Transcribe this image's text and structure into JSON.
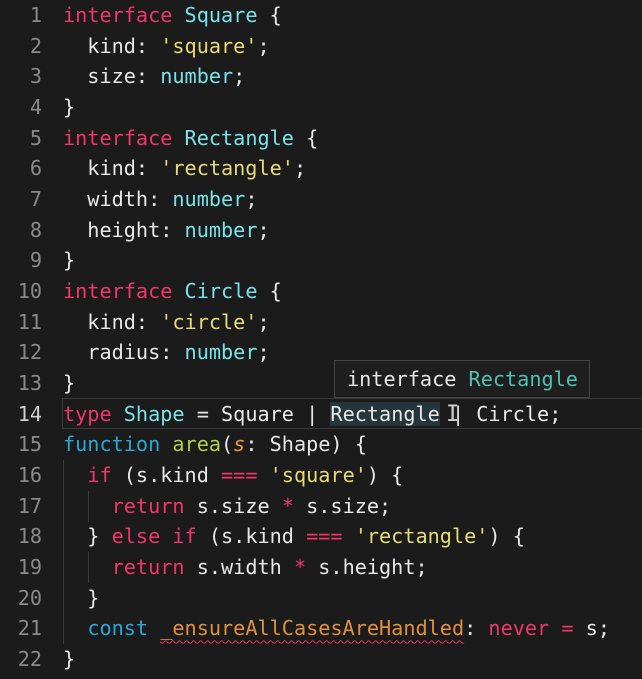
{
  "editor": {
    "current_line": 14,
    "lines": [
      {
        "n": "1",
        "tokens": [
          [
            "interface ",
            "kw"
          ],
          [
            "Square",
            "ty"
          ],
          [
            " {",
            "pl"
          ]
        ]
      },
      {
        "n": "2",
        "tokens": [
          [
            "  kind: ",
            "pl"
          ],
          [
            "'square'",
            "st"
          ],
          [
            ";",
            "pl"
          ]
        ]
      },
      {
        "n": "3",
        "tokens": [
          [
            "  size: ",
            "pl"
          ],
          [
            "number",
            "ty"
          ],
          [
            ";",
            "pl"
          ]
        ]
      },
      {
        "n": "4",
        "tokens": [
          [
            "}",
            "pl"
          ]
        ]
      },
      {
        "n": "5",
        "tokens": [
          [
            "interface ",
            "kw"
          ],
          [
            "Rectangle",
            "ty"
          ],
          [
            " {",
            "pl"
          ]
        ]
      },
      {
        "n": "6",
        "tokens": [
          [
            "  kind: ",
            "pl"
          ],
          [
            "'rectangle'",
            "st"
          ],
          [
            ";",
            "pl"
          ]
        ]
      },
      {
        "n": "7",
        "tokens": [
          [
            "  width: ",
            "pl"
          ],
          [
            "number",
            "ty"
          ],
          [
            ";",
            "pl"
          ]
        ]
      },
      {
        "n": "8",
        "tokens": [
          [
            "  height: ",
            "pl"
          ],
          [
            "number",
            "ty"
          ],
          [
            ";",
            "pl"
          ]
        ]
      },
      {
        "n": "9",
        "tokens": [
          [
            "}",
            "pl"
          ]
        ]
      },
      {
        "n": "10",
        "tokens": [
          [
            "interface ",
            "kw"
          ],
          [
            "Circle",
            "ty"
          ],
          [
            " {",
            "pl"
          ]
        ]
      },
      {
        "n": "11",
        "tokens": [
          [
            "  kind: ",
            "pl"
          ],
          [
            "'circle'",
            "st"
          ],
          [
            ";",
            "pl"
          ]
        ]
      },
      {
        "n": "12",
        "tokens": [
          [
            "  radius: ",
            "pl"
          ],
          [
            "number",
            "ty"
          ],
          [
            ";",
            "pl"
          ]
        ]
      },
      {
        "n": "13",
        "tokens": [
          [
            "}",
            "pl"
          ]
        ]
      },
      {
        "n": "14",
        "tokens": [
          [
            "type ",
            "kw"
          ],
          [
            "Shape",
            "ty"
          ],
          [
            " = Square | ",
            "pl"
          ],
          [
            "Rectangle",
            "pl hl"
          ],
          [
            " | Circle;",
            "pl"
          ]
        ]
      },
      {
        "n": "15",
        "tokens": [
          [
            "function ",
            "de"
          ],
          [
            "area",
            "fn"
          ],
          [
            "(",
            "pl"
          ],
          [
            "s",
            "pa"
          ],
          [
            ": Shape) {",
            "pl"
          ]
        ]
      },
      {
        "n": "16",
        "tokens": [
          [
            "  ",
            "pl"
          ],
          [
            "if",
            "kw"
          ],
          [
            " (s.kind ",
            "pl"
          ],
          [
            "===",
            "op"
          ],
          [
            " ",
            "pl"
          ],
          [
            "'square'",
            "st"
          ],
          [
            ") {",
            "pl"
          ]
        ]
      },
      {
        "n": "17",
        "tokens": [
          [
            "    ",
            "pl"
          ],
          [
            "return",
            "kw"
          ],
          [
            " s.size ",
            "pl"
          ],
          [
            "*",
            "op"
          ],
          [
            " s.size;",
            "pl"
          ]
        ]
      },
      {
        "n": "18",
        "tokens": [
          [
            "  } ",
            "pl"
          ],
          [
            "else if",
            "kw"
          ],
          [
            " (s.kind ",
            "pl"
          ],
          [
            "===",
            "op"
          ],
          [
            " ",
            "pl"
          ],
          [
            "'rectangle'",
            "st"
          ],
          [
            ") {",
            "pl"
          ]
        ]
      },
      {
        "n": "19",
        "tokens": [
          [
            "    ",
            "pl"
          ],
          [
            "return",
            "kw"
          ],
          [
            " s.width ",
            "pl"
          ],
          [
            "*",
            "op"
          ],
          [
            " s.height;",
            "pl"
          ]
        ]
      },
      {
        "n": "20",
        "tokens": [
          [
            "  }",
            "pl"
          ]
        ]
      },
      {
        "n": "21",
        "tokens": [
          [
            "  ",
            "pl"
          ],
          [
            "const",
            "de"
          ],
          [
            " ",
            "pl"
          ],
          [
            "_ensureAllCasesAreHandled",
            "va err"
          ],
          [
            ": ",
            "pl"
          ],
          [
            "never",
            "kw"
          ],
          [
            " ",
            "pl"
          ],
          [
            "=",
            "op"
          ],
          [
            " s;",
            "pl"
          ]
        ]
      },
      {
        "n": "22",
        "tokens": [
          [
            "}",
            "pl"
          ]
        ]
      }
    ]
  },
  "hover_tooltip": {
    "keyword": "interface",
    "name": "Rectangle"
  },
  "icons": {
    "cursor": "text-cursor-icon"
  }
}
